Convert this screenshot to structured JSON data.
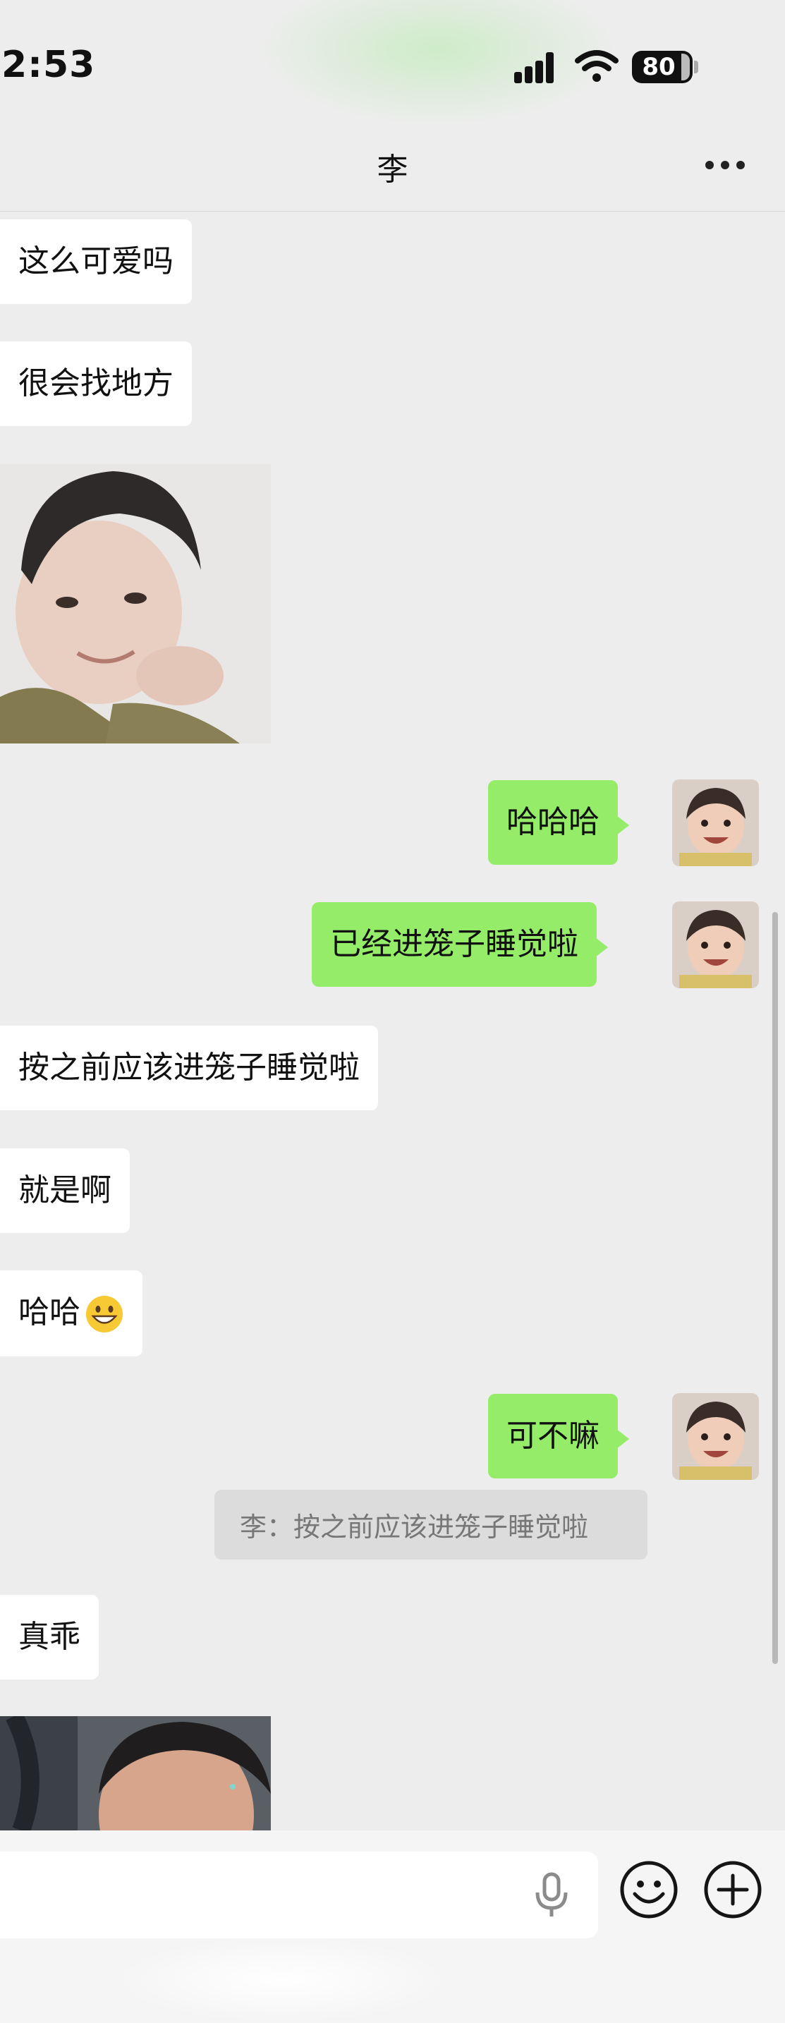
{
  "status_bar": {
    "time": "2:53",
    "battery": "80",
    "icons": [
      "signal-icon",
      "wifi-icon",
      "battery-icon"
    ]
  },
  "header": {
    "title": "李",
    "more_icon": "more-icon"
  },
  "messages": [
    {
      "side": "received",
      "type": "text",
      "text": "这么可爱吗"
    },
    {
      "side": "received",
      "type": "text",
      "text": "很会找地方"
    },
    {
      "side": "received",
      "type": "image",
      "description_icon": "photo"
    },
    {
      "side": "sent",
      "type": "text",
      "text": "哈哈哈"
    },
    {
      "side": "sent",
      "type": "text",
      "text": "已经进笼子睡觉啦"
    },
    {
      "side": "received",
      "type": "text",
      "text": "按之前应该进笼子睡觉啦"
    },
    {
      "side": "received",
      "type": "text",
      "text": "就是啊"
    },
    {
      "side": "received",
      "type": "text",
      "text": "哈哈",
      "emoji": "grinning-face"
    },
    {
      "side": "sent",
      "type": "text",
      "text": "可不嘛",
      "quote": "李：按之前应该进笼子睡觉啦"
    },
    {
      "side": "received",
      "type": "text",
      "text": "真乖"
    },
    {
      "side": "received",
      "type": "image",
      "description_icon": "photo"
    }
  ],
  "input_bar": {
    "voice_icon": "microphone-icon",
    "emoji_icon": "smiley-icon",
    "more_icon": "plus-icon"
  },
  "colors": {
    "background": "#ededed",
    "sent_bubble": "#95ec69",
    "received_bubble": "#ffffff"
  }
}
